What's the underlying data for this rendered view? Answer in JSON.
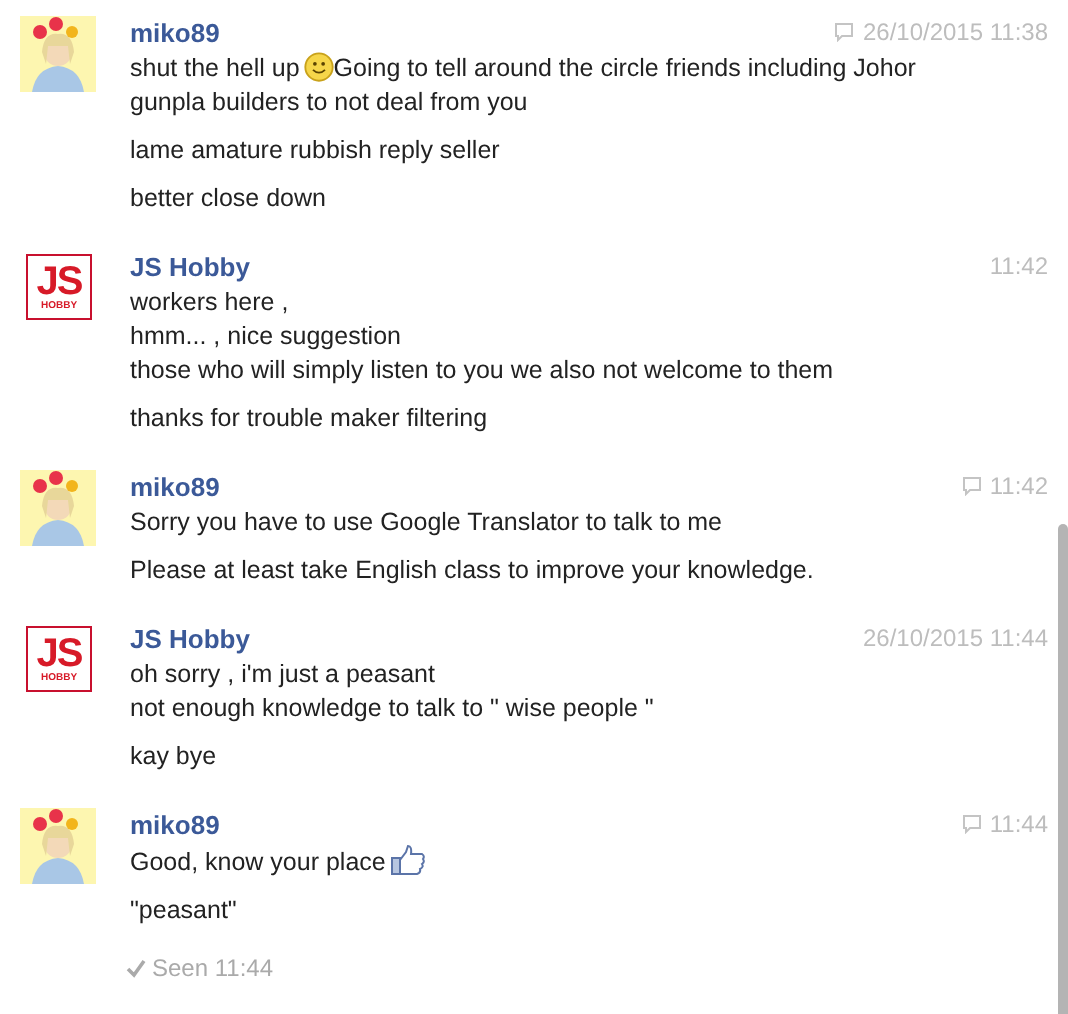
{
  "messages": [
    {
      "sender": "miko89",
      "avatar": {
        "kind": "user"
      },
      "time": "26/10/2015 11:38",
      "web_icon": true,
      "paragraphs": [
        [
          {
            "kind": "text",
            "text": "shut the hell up"
          },
          {
            "kind": "smile"
          },
          {
            "kind": "text",
            "text": "Going to tell around the circle friends including Johor gunpla builders to not deal from you"
          }
        ],
        [
          {
            "kind": "text",
            "text": "lame amature rubbish reply seller"
          }
        ],
        [
          {
            "kind": "text",
            "text": "better close down"
          }
        ]
      ]
    },
    {
      "sender": "JS Hobby",
      "avatar": {
        "kind": "logo",
        "text": "JS",
        "sub": "HOBBY"
      },
      "time": "11:42",
      "web_icon": false,
      "paragraphs": [
        [
          {
            "kind": "text",
            "text": "workers here ,"
          },
          {
            "kind": "break"
          },
          {
            "kind": "text",
            "text": "hmm...  , nice suggestion"
          },
          {
            "kind": "break"
          },
          {
            "kind": "text",
            "text": "those who will simply listen to you we also not welcome to them"
          }
        ],
        [
          {
            "kind": "text",
            "text": "thanks for trouble maker filtering"
          }
        ]
      ]
    },
    {
      "sender": "miko89",
      "avatar": {
        "kind": "user"
      },
      "time": "11:42",
      "web_icon": true,
      "paragraphs": [
        [
          {
            "kind": "text",
            "text": "Sorry you have to use Google Translator to talk to me"
          }
        ],
        [
          {
            "kind": "text",
            "text": "Please at least take English class to improve your knowledge."
          }
        ]
      ]
    },
    {
      "sender": "JS Hobby",
      "avatar": {
        "kind": "logo",
        "text": "JS",
        "sub": "HOBBY"
      },
      "time": "26/10/2015 11:44",
      "web_icon": false,
      "paragraphs": [
        [
          {
            "kind": "text",
            "text": "oh sorry , i'm just a peasant"
          },
          {
            "kind": "break"
          },
          {
            "kind": "text",
            "text": "not enough knowledge to talk to \" wise people \""
          }
        ],
        [
          {
            "kind": "text",
            "text": "kay bye"
          }
        ]
      ]
    },
    {
      "sender": "miko89",
      "avatar": {
        "kind": "user"
      },
      "time": "11:44",
      "web_icon": true,
      "paragraphs": [
        [
          {
            "kind": "text",
            "text": "Good, know your place"
          },
          {
            "kind": "like"
          }
        ],
        [
          {
            "kind": "text",
            "text": "\"peasant\""
          }
        ]
      ]
    }
  ],
  "seen": "Seen 11:44"
}
